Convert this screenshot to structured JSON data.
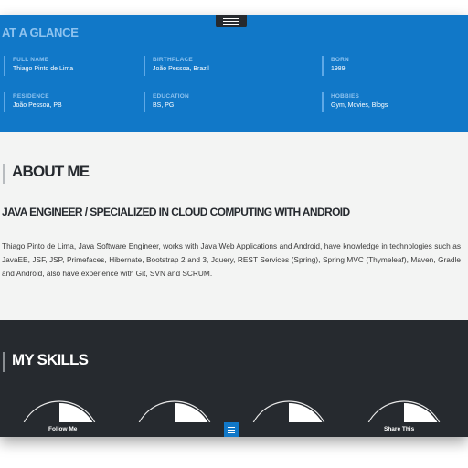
{
  "glance": {
    "title": "AT A GLANCE",
    "items": [
      {
        "label": "FULL NAME",
        "value": "Thiago Pinto de Lima"
      },
      {
        "label": "BIRTHPLACE",
        "value": "João Pessoa, Brazil"
      },
      {
        "label": "BORN",
        "value": "1989"
      },
      {
        "label": "RESIDENCE",
        "value": "João Pessoa, PB"
      },
      {
        "label": "EDUCATION",
        "value": "BS, PG"
      },
      {
        "label": "HOBBIES",
        "value": "Gym, Movies, Blogs"
      }
    ]
  },
  "about": {
    "title": "ABOUT ME",
    "subtitle": "JAVA ENGINEER / SPECIALIZED IN CLOUD COMPUTING WITH ANDROID",
    "text": "Thiago Pinto de Lima, Java Software Engineer, works with Java Web Applications and Android, have knowledge in technologies such as JavaEE, JSF, JSP, Primefaces, Hibernate, Bootstrap 2 and 3, Jquery, REST Services (Spring), Spring MVC (Thymeleaf), Maven, Gradle and Android, also have experience with Git, SVN and SCRUM."
  },
  "skills": {
    "title": "MY SKILLS",
    "gauges": [
      {
        "percent": 0.22
      },
      {
        "percent": 0.22
      },
      {
        "percent": 0.22
      },
      {
        "percent": 0.22
      }
    ]
  },
  "bottom_bar": {
    "follow_label": "Follow Me",
    "share_label": "Share This",
    "menu_icon": "hamburger-icon"
  },
  "colors": {
    "primary_blue": "#1178c8",
    "dark": "#262a2f",
    "light_bg": "#f3f4f3"
  }
}
